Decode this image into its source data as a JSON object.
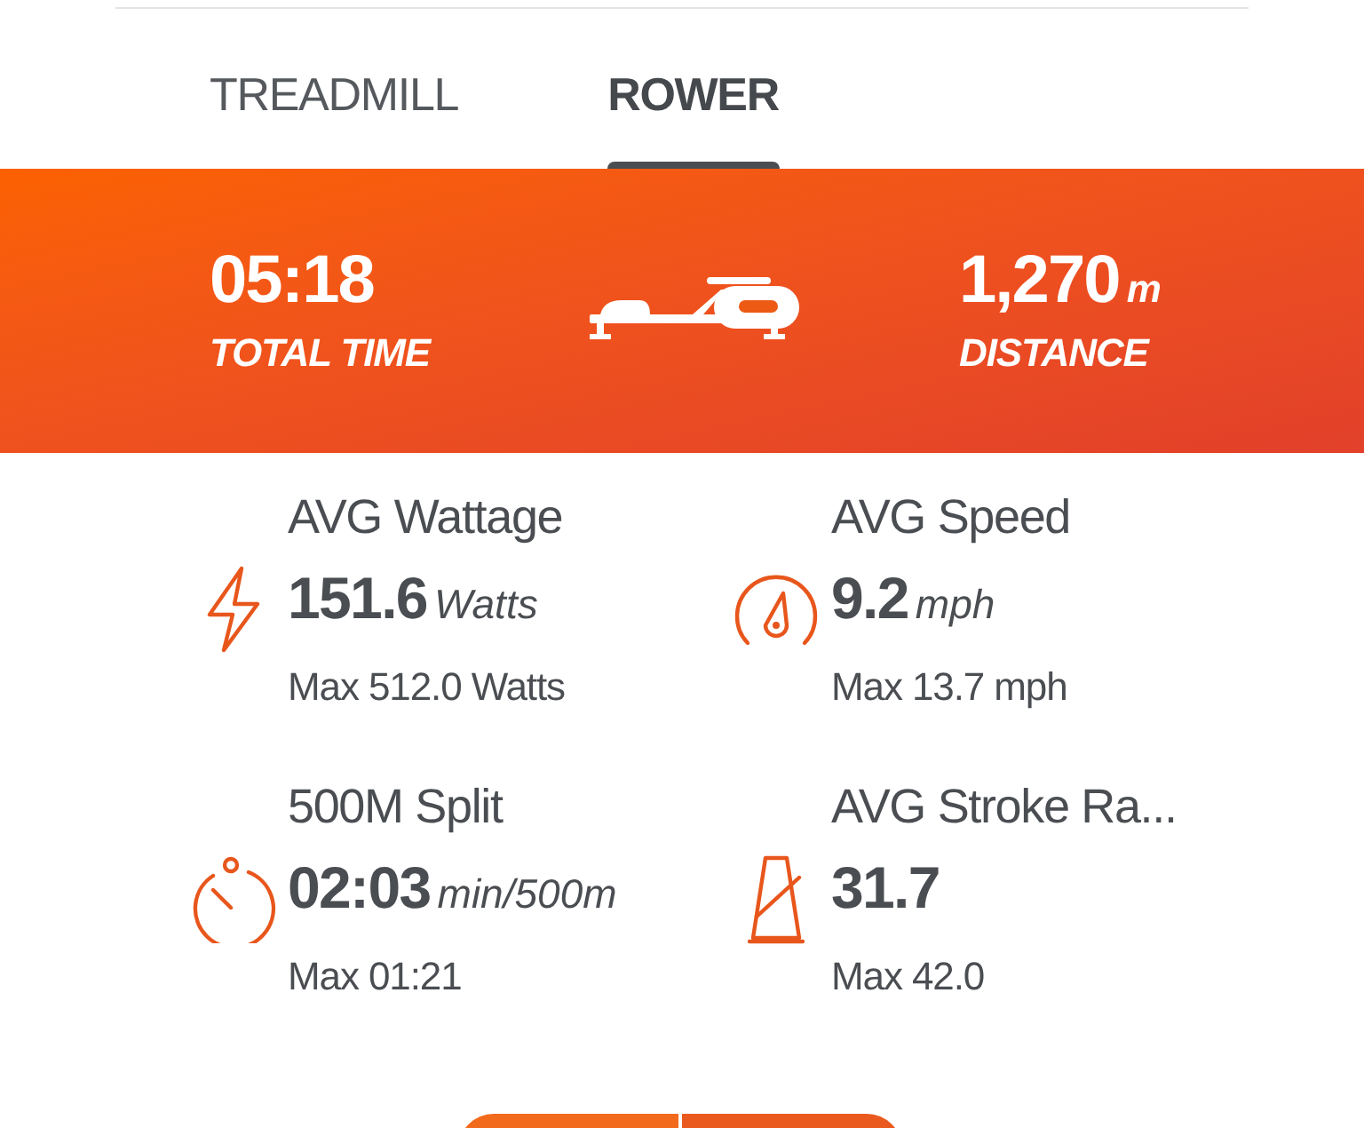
{
  "tabs": [
    {
      "label": "TREADMILL",
      "selected": false
    },
    {
      "label": "ROWER",
      "selected": true
    }
  ],
  "summary": {
    "time": {
      "value": "05:18",
      "label": "TOTAL TIME"
    },
    "distance": {
      "value": "1,270",
      "unit": "m",
      "label": "DISTANCE"
    }
  },
  "metrics": [
    {
      "kind": "bolt",
      "title": "AVG Wattage",
      "value": "151.6",
      "unit": "Watts",
      "max": "Max 512.0 Watts"
    },
    {
      "kind": "gauge",
      "title": "AVG Speed",
      "value": "9.2",
      "unit": "mph",
      "max": "Max 13.7 mph"
    },
    {
      "kind": "stopwatch",
      "title": "500M Split",
      "value": "02:03",
      "unit": "min/500m",
      "max": "Max 01:21"
    },
    {
      "kind": "metronome",
      "title": "AVG Stroke Ra...",
      "value": "31.7",
      "max": "Max 42.0"
    }
  ]
}
